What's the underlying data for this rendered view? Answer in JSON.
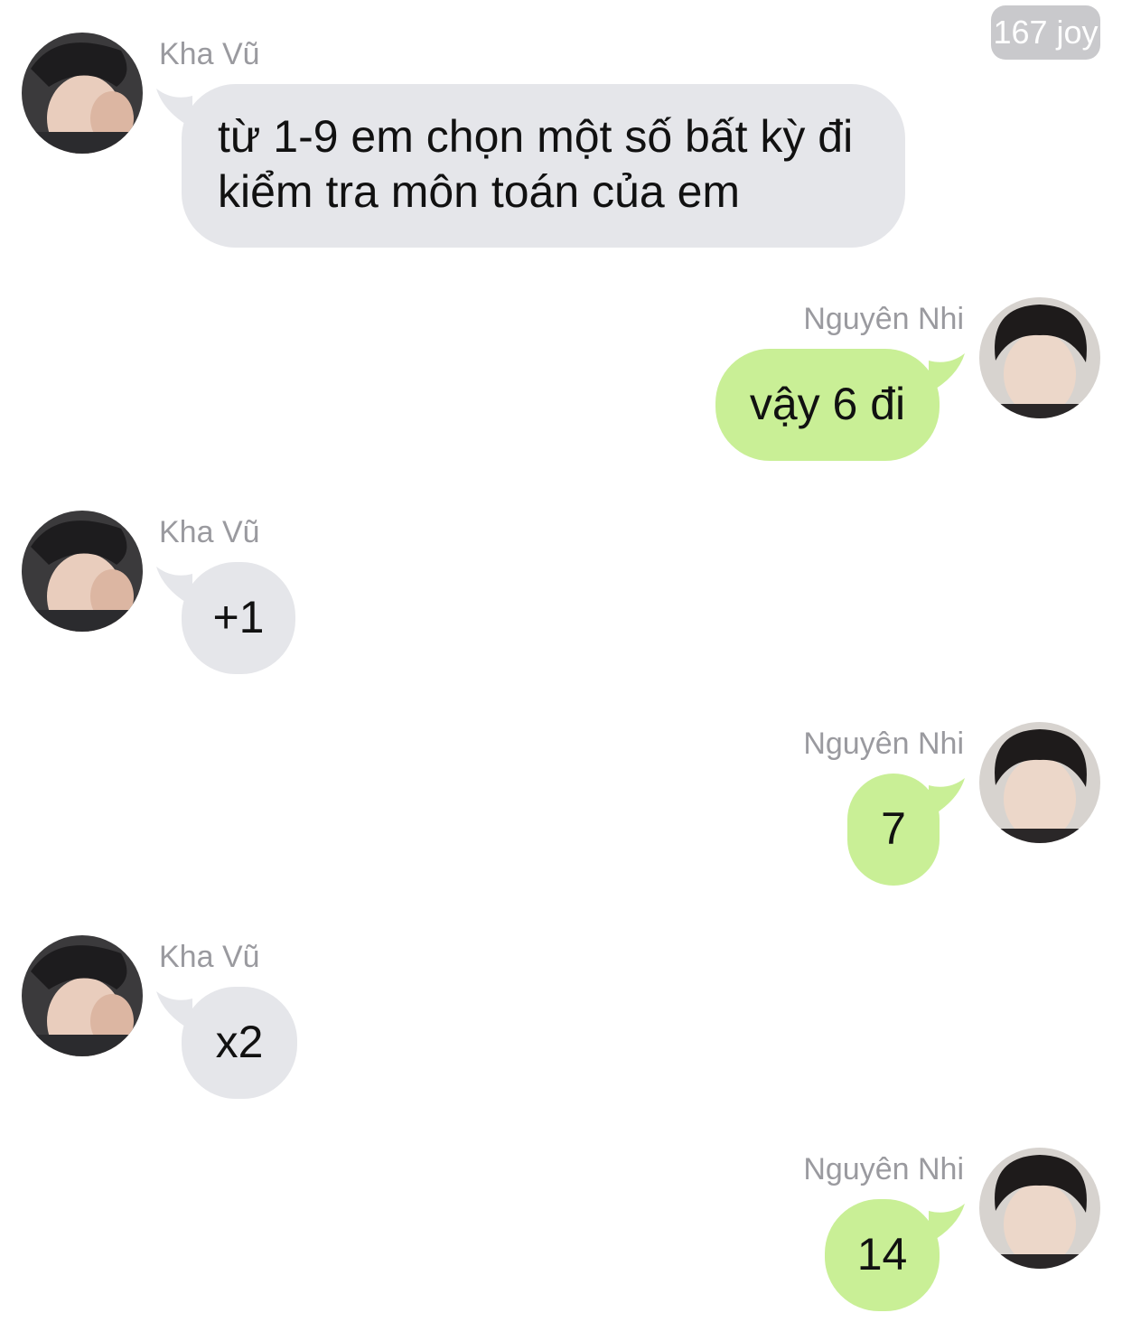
{
  "points_badge": "167 joy",
  "participants": {
    "left": "Kha Vũ",
    "right": "Nguyên Nhi"
  },
  "colors": {
    "incoming_bubble": "#e5e6ea",
    "outgoing_bubble": "#c9ef96",
    "sender_name": "#9a9a9f",
    "badge_bg": "#c9c9cc"
  },
  "messages": [
    {
      "sender": "Kha Vũ",
      "side": "incoming",
      "text_line1": "từ 1-9 em chọn một số bất kỳ đi",
      "text_line2": "kiểm tra môn toán của em"
    },
    {
      "sender": "Nguyên Nhi",
      "side": "outgoing",
      "text": "vậy 6 đi"
    },
    {
      "sender": "Kha Vũ",
      "side": "incoming",
      "text": "+1"
    },
    {
      "sender": "Nguyên Nhi",
      "side": "outgoing",
      "text": "7"
    },
    {
      "sender": "Kha Vũ",
      "side": "incoming",
      "text": "x2"
    },
    {
      "sender": "Nguyên Nhi",
      "side": "outgoing",
      "text": "14"
    }
  ]
}
